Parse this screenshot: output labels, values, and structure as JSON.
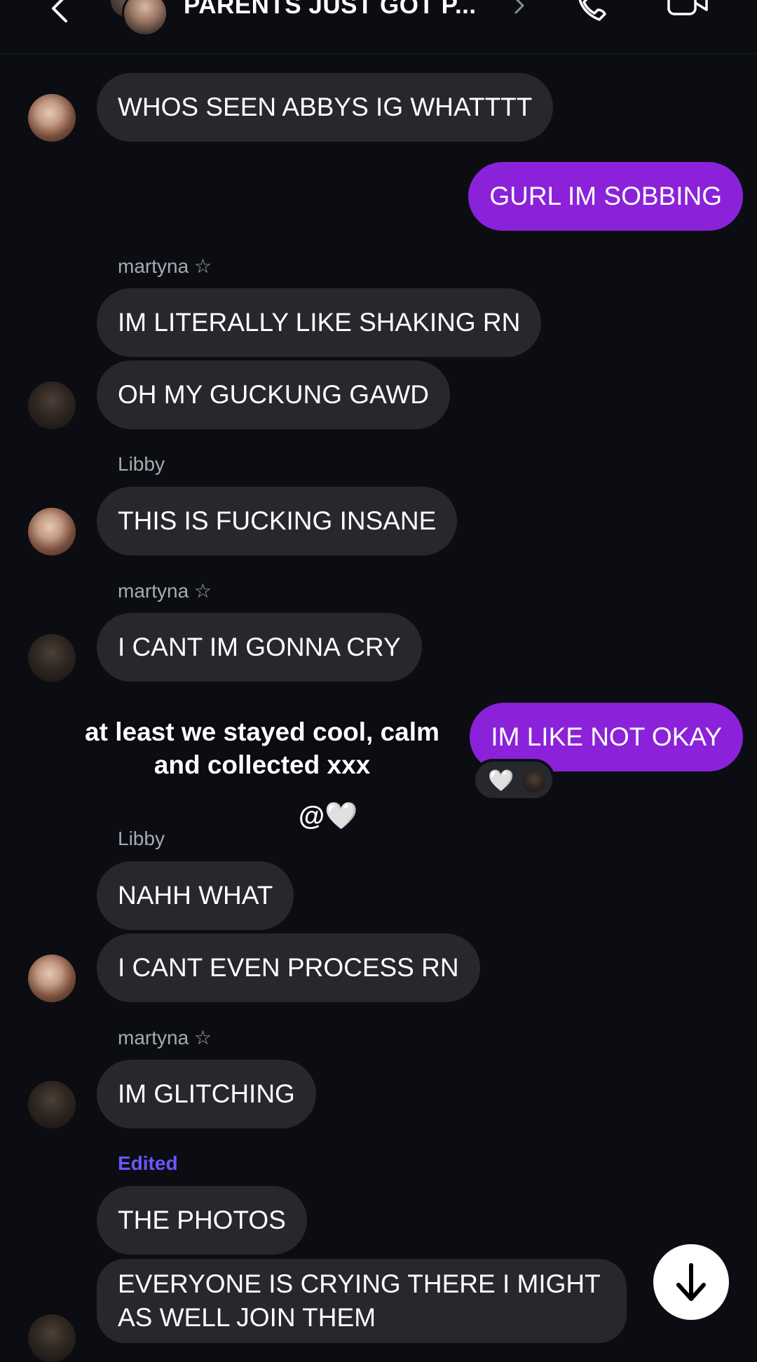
{
  "header": {
    "title": "PARENTS JUST GOT P...",
    "back_icon": "chevron-left-icon",
    "call_icon": "phone-icon",
    "video_icon": "video-camera-icon"
  },
  "messages": [
    {
      "text": "WHOS SEEN ABBYS IG WHATTTT"
    },
    {
      "text": "GURL IM SOBBING"
    },
    {
      "sender": "martyna ☆"
    },
    {
      "text": "IM LITERALLY LIKE SHAKING RN"
    },
    {
      "text": "OH MY GUCKUNG GAWD"
    },
    {
      "sender": "Libby"
    },
    {
      "text": "THIS IS FUCKING INSANE"
    },
    {
      "sender": "martyna ☆"
    },
    {
      "text": "I CANT IM GONNA CRY"
    },
    {
      "text": "IM LIKE NOT OKAY"
    },
    {
      "sender": "Libby"
    },
    {
      "text": "NAHH WHAT"
    },
    {
      "text": "I CANT EVEN PROCESS RN"
    },
    {
      "sender": "martyna ☆"
    },
    {
      "text": "IM GLITCHING"
    },
    {
      "edited": "Edited"
    },
    {
      "text": "THE PHOTOS"
    },
    {
      "text": "EVERYONE IS CRYING THERE I MIGHT AS WELL JOIN THEM"
    }
  ],
  "reaction": {
    "emoji": "🤍"
  },
  "overlay": {
    "caption": "at least we stayed cool, calm and collected xxx",
    "tag": "@🤍"
  },
  "colors": {
    "background": "#0b0d12",
    "incoming_bubble": "#26282d",
    "outgoing_bubble": "#8b22d9",
    "edited_label": "#6e55ff"
  }
}
